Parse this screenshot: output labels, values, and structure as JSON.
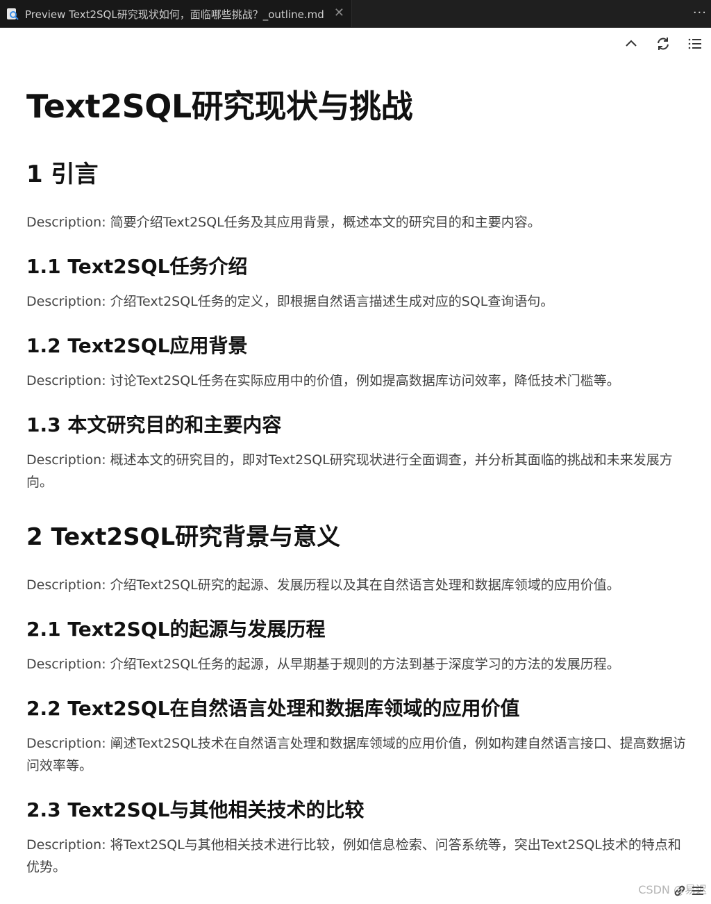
{
  "tab": {
    "title": "Preview Text2SQL研究现状如何，面临哪些挑战？_outline.md",
    "close_glyph": "✕",
    "more_glyph": "···"
  },
  "toolbar": {
    "icons": [
      "chevron-up-icon",
      "refresh-icon",
      "outline-list-icon"
    ]
  },
  "document": {
    "title": "Text2SQL研究现状与挑战",
    "s1": {
      "heading": "1 引言",
      "desc": "Description: 简要介绍Text2SQL任务及其应用背景，概述本文的研究目的和主要内容。",
      "sub1": {
        "heading": "1.1 Text2SQL任务介绍",
        "desc": "Description: 介绍Text2SQL任务的定义，即根据自然语言描述生成对应的SQL查询语句。"
      },
      "sub2": {
        "heading": "1.2 Text2SQL应用背景",
        "desc": "Description: 讨论Text2SQL任务在实际应用中的价值，例如提高数据库访问效率，降低技术门槛等。"
      },
      "sub3": {
        "heading": "1.3 本文研究目的和主要内容",
        "desc": "Description: 概述本文的研究目的，即对Text2SQL研究现状进行全面调查，并分析其面临的挑战和未来发展方向。"
      }
    },
    "s2": {
      "heading": "2 Text2SQL研究背景与意义",
      "desc": "Description: 介绍Text2SQL研究的起源、发展历程以及其在自然语言处理和数据库领域的应用价值。",
      "sub1": {
        "heading": "2.1 Text2SQL的起源与发展历程",
        "desc": "Description: 介绍Text2SQL任务的起源，从早期基于规则的方法到基于深度学习的方法的发展历程。"
      },
      "sub2": {
        "heading": "2.2 Text2SQL在自然语言处理和数据库领域的应用价值",
        "desc": "Description: 阐述Text2SQL技术在自然语言处理和数据库领域的应用价值，例如构建自然语言接口、提高数据访问效率等。"
      },
      "sub3": {
        "heading": "2.3 Text2SQL与其他相关技术的比较",
        "desc": "Description: 将Text2SQL与其他相关技术进行比较，例如信息检索、问答系统等，突出Text2SQL技术的特点和优势。"
      }
    }
  },
  "watermark": "CSDN @易迟"
}
